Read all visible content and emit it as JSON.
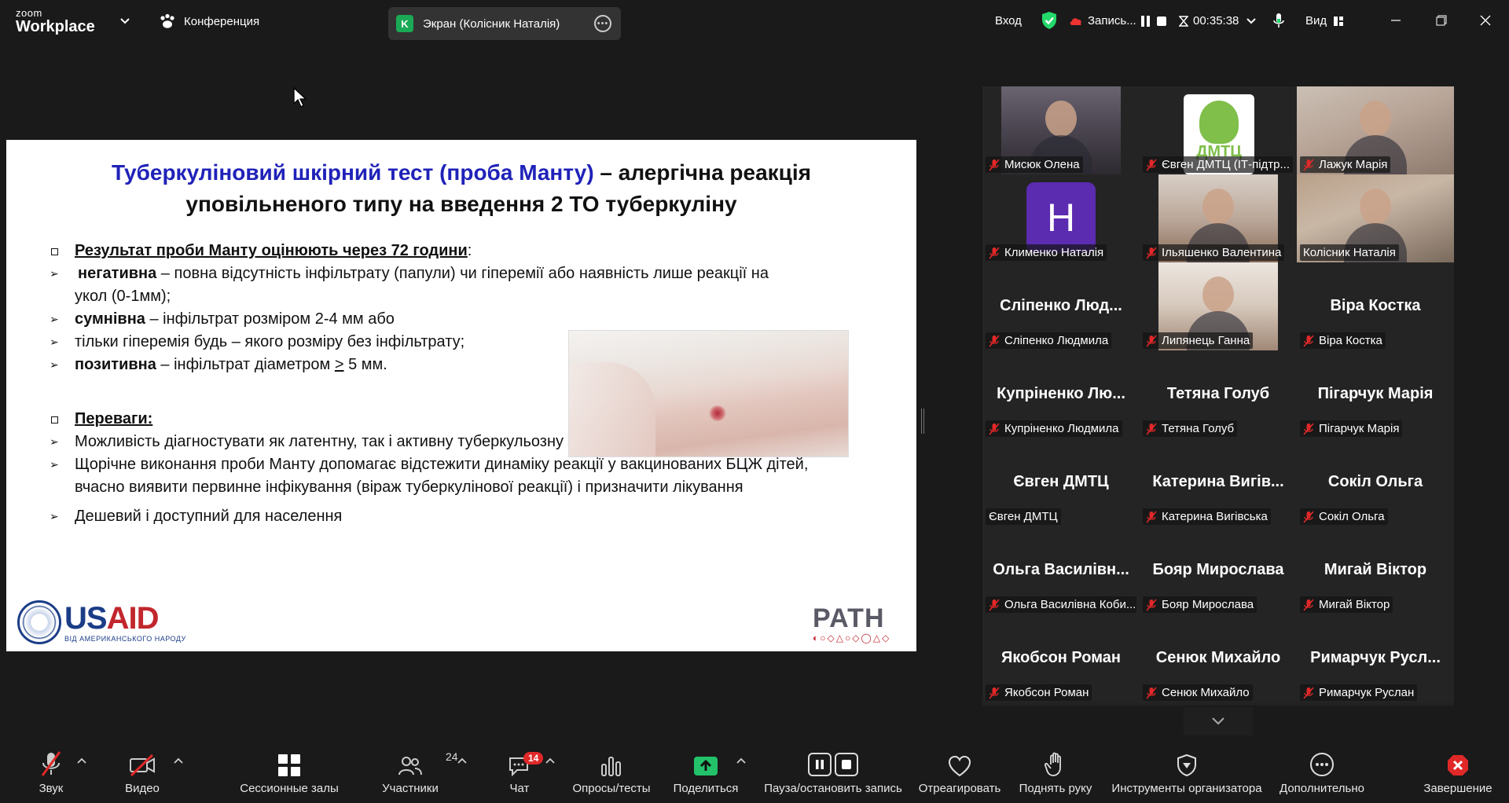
{
  "app": {
    "logo_top": "zoom",
    "logo_bottom": "Workplace",
    "conference_label": "Конференция",
    "share_label": "Экран (Колісник Наталія)",
    "share_avatar_letter": "K",
    "enter_label": "Вход",
    "record_label": "Запись...",
    "timer": "00:35:38",
    "view_label": "Вид"
  },
  "slide": {
    "title_blue": "Туберкуліновий шкірний тест (проба Манту)",
    "title_rest_1": " – алергічна реакція",
    "title_line2": "уповільненого типу на введення 2 ТО туберкуліну",
    "s1_heading": "Результат проби Манту оцінюють через 72 години",
    "s1_colon": ":",
    "neg_bold": "негативна",
    "neg_text": " – повна відсутність інфільтрату (папули) чи гіперемії або наявність лише реакції на укол (0-1мм);",
    "sus_bold": "сумнівна",
    "sus_text": " – інфільтрат розміром 2-4 мм або",
    "hyper_text": "тільки гіперемія будь – якого розміру без інфільтрату;",
    "pos_bold": "позитивна",
    "pos_text_a": " – інфільтрат діаметром ",
    "pos_ge": ">",
    "pos_text_b": " 5 мм.",
    "s2_heading": "Переваги:",
    "adv1": "Можливість діагностувати як латентну, так і активну туберкульозну інфекцію",
    "adv2": "Щорічне виконання проби Манту допомагає відстежити динаміку реакції у вакцинованих БЦЖ дітей, вчасно виявити первинне інфікування (віраж туберкулінової реакції) і призначити лікування",
    "adv3": "Дешевий і доступний для населення",
    "usaid_us": "US",
    "usaid_aid": "AID",
    "usaid_sub": "ВІД АМЕРИКАНСЬКОГО НАРОДУ",
    "path_logo": "PATH",
    "path_shapes": "◐○◇△○◇◯△◇"
  },
  "gallery": {
    "tiles": [
      {
        "label": "Мисюк Олена",
        "muted": true
      },
      {
        "label": "Євген ДМТЦ (ІТ-підтр...",
        "muted": true,
        "logo_text": "ДМТЦ"
      },
      {
        "label": "Лажук Марія",
        "muted": true
      },
      {
        "label": "Клименко Наталія",
        "muted": true,
        "avatar_letter": "H"
      },
      {
        "label": "Ільяшенко Валентина",
        "muted": true
      },
      {
        "label": "Колісник Наталія",
        "muted": false
      },
      {
        "name": "Сліпенко Люд...",
        "label": "Сліпенко Людмила",
        "muted": true
      },
      {
        "label": "Липянець Ганна",
        "muted": true
      },
      {
        "name": "Віра Костка",
        "label": "Віра Костка",
        "muted": true
      },
      {
        "name": "Купріненко Лю...",
        "label": "Купріненко Людмила",
        "muted": true
      },
      {
        "name": "Тетяна Голуб",
        "label": "Тетяна Голуб",
        "muted": true
      },
      {
        "name": "Пігарчук Марія",
        "label": "Пігарчук Марія",
        "muted": true
      },
      {
        "name": "Євген ДМТЦ",
        "label": "Євген ДМТЦ",
        "muted": false
      },
      {
        "name": "Катерина Вигів...",
        "label": "Катерина Вигівська",
        "muted": true
      },
      {
        "name": "Сокіл Ольга",
        "label": "Сокіл Ольга",
        "muted": true
      },
      {
        "name": "Ольга Василівн...",
        "label": "Ольга Василівна Коби...",
        "muted": true
      },
      {
        "name": "Бояр Мирослава",
        "label": "Бояр Мирослава",
        "muted": true
      },
      {
        "name": "Мигай Віктор",
        "label": "Мигай Віктор",
        "muted": true
      },
      {
        "name": "Якобсон Роман",
        "label": "Якобсон Роман",
        "muted": true
      },
      {
        "name": "Сенюк Михайло",
        "label": "Сенюк Михайло",
        "muted": true
      },
      {
        "name": "Римарчук Русл...",
        "label": "Римарчук Руслан",
        "muted": true
      }
    ]
  },
  "toolbar": {
    "audio": "Звук",
    "video": "Видео",
    "breakout": "Сессионные залы",
    "participants": "Участники",
    "participants_count": "24",
    "chat": "Чат",
    "chat_badge": "14",
    "polls": "Опросы/тесты",
    "share": "Поделиться",
    "record": "Пауза/остановить запись",
    "react": "Отреагировать",
    "raise": "Поднять руку",
    "host_tools": "Инструменты организатора",
    "more": "Дополнительно",
    "end": "Завершение"
  },
  "colors": {
    "accent_green": "#23d96a",
    "mute_red": "#e02828",
    "title_blue": "#1f22b8"
  }
}
